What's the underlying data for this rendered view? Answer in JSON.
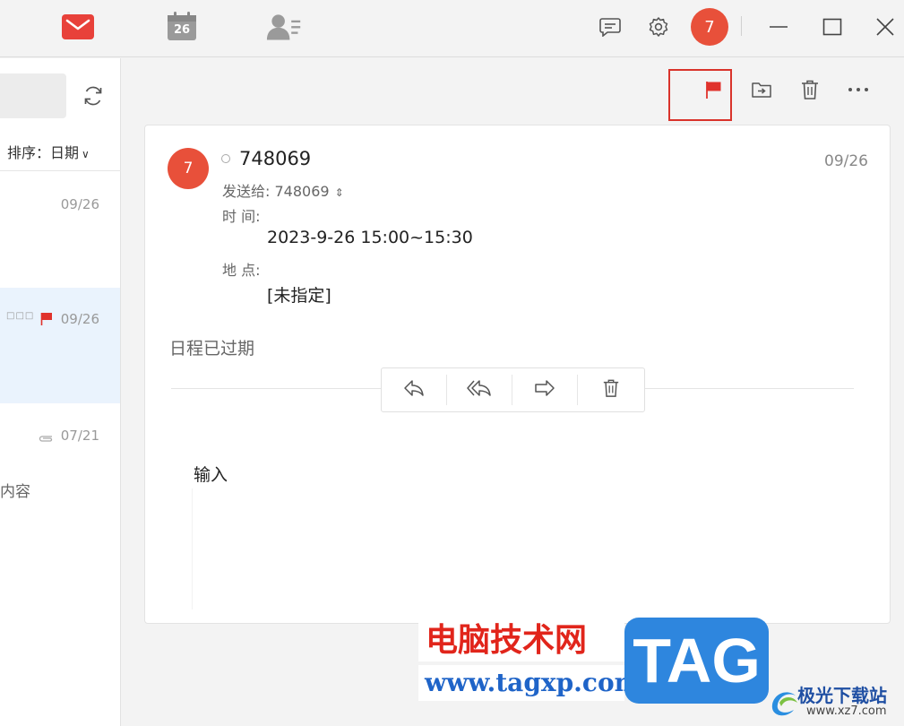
{
  "titlebar": {
    "nav": [
      {
        "name": "mail-icon"
      },
      {
        "name": "calendar-icon",
        "date": "26"
      },
      {
        "name": "contacts-icon"
      }
    ],
    "buttons": [
      "chat-icon",
      "gear-icon",
      "minimize-icon",
      "maximize-icon",
      "close-icon"
    ],
    "avatar_label": "7",
    "accent_color": "#e8503a"
  },
  "mail_list": {
    "sort_label": "排序：日期",
    "items": [
      {
        "date": "09/26",
        "selected": false
      },
      {
        "date": "09/26",
        "selected": true,
        "flagged": true,
        "status": "□□□"
      },
      {
        "date": "07/21",
        "attachment": true,
        "preview": "内容"
      }
    ]
  },
  "message": {
    "avatar_label": "7",
    "sender": "748069",
    "date": "09/26",
    "recipient_label": "发送给: 748069",
    "recipient_toggle": "⌃⌄",
    "time_label": "时 间:",
    "time_value": "2023-9-26 15:00~15:30",
    "location_label": "地 点:",
    "location_value": "[未指定]",
    "status_text": "日程已过期",
    "body": "输入"
  },
  "toolbar": {
    "buttons": [
      "flag-icon",
      "move-to-folder-icon",
      "delete-icon",
      "more-icon"
    ],
    "flag_color": "#e0322c"
  },
  "action_bar": {
    "buttons": [
      "reply-icon",
      "reply-all-icon",
      "forward-icon",
      "delete-icon"
    ]
  },
  "watermark": {
    "cn_title": "电脑技术网",
    "url": "www.tagxp.com",
    "tag": "TAG",
    "site_name": "极光下载站",
    "site_url": "www.xz7.com"
  }
}
